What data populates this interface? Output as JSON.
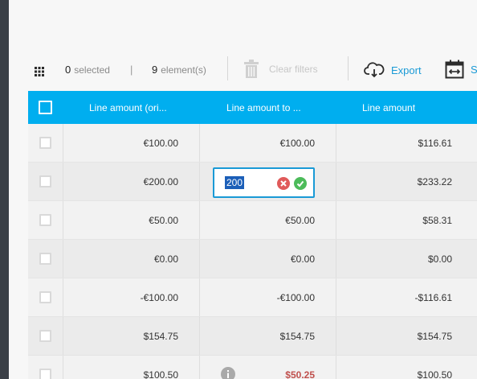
{
  "toolbar": {
    "selected_count": "0",
    "selected_label": "selected",
    "separator": "|",
    "element_count": "9",
    "element_label": "element(s)",
    "clear_filters_label": "Clear filters",
    "export_label": "Export",
    "schedule_label": "S"
  },
  "table": {
    "columns": [
      "Line amount (ori...",
      "Line amount to ...",
      "Line amount"
    ],
    "rows": [
      {
        "c1": "€100.00",
        "c2": "€100.00",
        "c3": "$116.61"
      },
      {
        "c1": "€200.00",
        "c2": "",
        "c3": "$233.22",
        "editing": true
      },
      {
        "c1": "€50.00",
        "c2": "€50.00",
        "c3": "$58.31"
      },
      {
        "c1": "€0.00",
        "c2": "€0.00",
        "c3": "$0.00"
      },
      {
        "c1": "-€100.00",
        "c2": "-€100.00",
        "c3": "-$116.61"
      },
      {
        "c1": "$154.75",
        "c2": "$154.75",
        "c3": "$154.75"
      },
      {
        "c1": "$100.50",
        "c2": "$50.25",
        "c3": "$100.50",
        "c2_highlight": true
      }
    ],
    "edit_value": "200"
  },
  "colors": {
    "header_bg": "#00aeef",
    "accent": "#1a9ad6",
    "negative": "#c0504d",
    "cancel": "#e05a5a",
    "confirm": "#4cbb5a"
  }
}
